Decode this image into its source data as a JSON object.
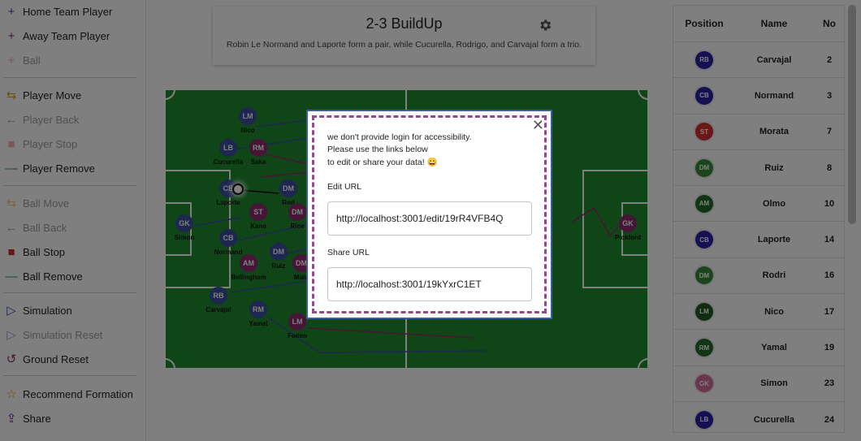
{
  "sidebar": {
    "items": [
      {
        "label": "Home Team Player",
        "icon": "plus-icon",
        "glyph": "+",
        "color": "#3b4fa0",
        "disabled": false
      },
      {
        "label": "Away Team Player",
        "icon": "plus-icon",
        "glyph": "+",
        "color": "#8e2a6e",
        "disabled": false
      },
      {
        "label": "Ball",
        "icon": "plus-icon",
        "glyph": "+",
        "color": "#e57373",
        "disabled": true
      },
      {
        "label": "Player Move",
        "icon": "move-icon",
        "glyph": "⇆",
        "color": "#e6a100",
        "disabled": false
      },
      {
        "label": "Player Back",
        "icon": "arrow-left-icon",
        "glyph": "←",
        "color": "#555555",
        "disabled": true
      },
      {
        "label": "Player Stop",
        "icon": "stop-icon",
        "glyph": "■",
        "color": "#e57373",
        "disabled": true
      },
      {
        "label": "Player Remove",
        "icon": "minus-icon",
        "glyph": "—",
        "color": "#2e8b57",
        "disabled": false
      },
      {
        "label": "Ball Move",
        "icon": "move-icon",
        "glyph": "⇆",
        "color": "#e6a100",
        "disabled": true
      },
      {
        "label": "Ball Back",
        "icon": "arrow-left-icon",
        "glyph": "←",
        "color": "#555555",
        "disabled": true
      },
      {
        "label": "Ball Stop",
        "icon": "stop-icon",
        "glyph": "■",
        "color": "#d32f2f",
        "disabled": false
      },
      {
        "label": "Ball Remove",
        "icon": "minus-icon",
        "glyph": "—",
        "color": "#2e8b57",
        "disabled": false
      },
      {
        "label": "Simulation",
        "icon": "play-icon",
        "glyph": "▷",
        "color": "#3b4fa0",
        "disabled": false
      },
      {
        "label": "Simulation Reset",
        "icon": "play-icon",
        "glyph": "▷",
        "color": "#3b4fa0",
        "disabled": true
      },
      {
        "label": "Ground Reset",
        "icon": "reset-icon",
        "glyph": "↺",
        "color": "#8e2a6e",
        "disabled": false
      },
      {
        "label": "Recommend Formation",
        "icon": "star-icon",
        "glyph": "☆",
        "color": "#e6a100",
        "disabled": false
      },
      {
        "label": "Share",
        "icon": "share-icon",
        "glyph": "⇪",
        "color": "#6a1b9a",
        "disabled": false
      }
    ]
  },
  "title_card": {
    "title": "2-3 BuildUp",
    "subtitle": "Robin Le Normand and Laporte form a pair, while Cucurella, Rodrigo, and Carvajal form a trio."
  },
  "pitch": {
    "colors": {
      "grass": "#1e8a2e",
      "lines": "#ffffff",
      "home": "#3b4fa0",
      "away": "#8e2a6e"
    },
    "players": [
      {
        "pos": "LM",
        "name": "Nico",
        "team": "home"
      },
      {
        "pos": "LB",
        "name": "Cucurella",
        "team": "home"
      },
      {
        "pos": "RM",
        "name": "Saka",
        "team": "away"
      },
      {
        "pos": "CB",
        "name": "Laporte",
        "team": "home"
      },
      {
        "pos": "DM",
        "name": "Rod",
        "team": "home"
      },
      {
        "pos": "ST",
        "name": "Kane",
        "team": "away"
      },
      {
        "pos": "DM",
        "name": "Rice",
        "team": "away"
      },
      {
        "pos": "GK",
        "name": "Simon",
        "team": "home"
      },
      {
        "pos": "CB",
        "name": "Normand",
        "team": "home"
      },
      {
        "pos": "AM",
        "name": "Bellingham",
        "team": "away"
      },
      {
        "pos": "DM",
        "name": "Ruiz",
        "team": "home"
      },
      {
        "pos": "DM",
        "name": "Main",
        "team": "away"
      },
      {
        "pos": "RB",
        "name": "Carvajal",
        "team": "home"
      },
      {
        "pos": "RM",
        "name": "Yamal",
        "team": "home"
      },
      {
        "pos": "LM",
        "name": "Foden",
        "team": "away"
      },
      {
        "pos": "GK",
        "name": "Pickford",
        "team": "away"
      }
    ]
  },
  "roster": {
    "headers": {
      "position": "Position",
      "name": "Name",
      "no": "No"
    },
    "rows": [
      {
        "pos": "RB",
        "name": "Carvajal",
        "no": "2",
        "color": "#2a1fa8"
      },
      {
        "pos": "CB",
        "name": "Normand",
        "no": "3",
        "color": "#2a1fa8"
      },
      {
        "pos": "ST",
        "name": "Morata",
        "no": "7",
        "color": "#d32f2f"
      },
      {
        "pos": "DM",
        "name": "Ruiz",
        "no": "8",
        "color": "#3a8a3a"
      },
      {
        "pos": "AM",
        "name": "Olmo",
        "no": "10",
        "color": "#1f6b2a"
      },
      {
        "pos": "CB",
        "name": "Laporte",
        "no": "14",
        "color": "#2a1fa8"
      },
      {
        "pos": "DM",
        "name": "Rodri",
        "no": "16",
        "color": "#3a8a3a"
      },
      {
        "pos": "LM",
        "name": "Nico",
        "no": "17",
        "color": "#1f5a1f"
      },
      {
        "pos": "RM",
        "name": "Yamal",
        "no": "19",
        "color": "#1f6b2a"
      },
      {
        "pos": "GK",
        "name": "Simon",
        "no": "23",
        "color": "#d46a9a"
      },
      {
        "pos": "LB",
        "name": "Cucurella",
        "no": "24",
        "color": "#2a1fa8"
      }
    ]
  },
  "modal": {
    "message_line1": "we don't provide login for accessibility.",
    "message_line2": "Please use the links below",
    "message_line3": "to edit or share your data! 😀",
    "edit_label": "Edit URL",
    "edit_url": "http://localhost:3001/edit/19rR4VFB4Q",
    "share_label": "Share URL",
    "share_url": "http://localhost:3001/19kYxrC1ET",
    "close_glyph": "✕"
  }
}
